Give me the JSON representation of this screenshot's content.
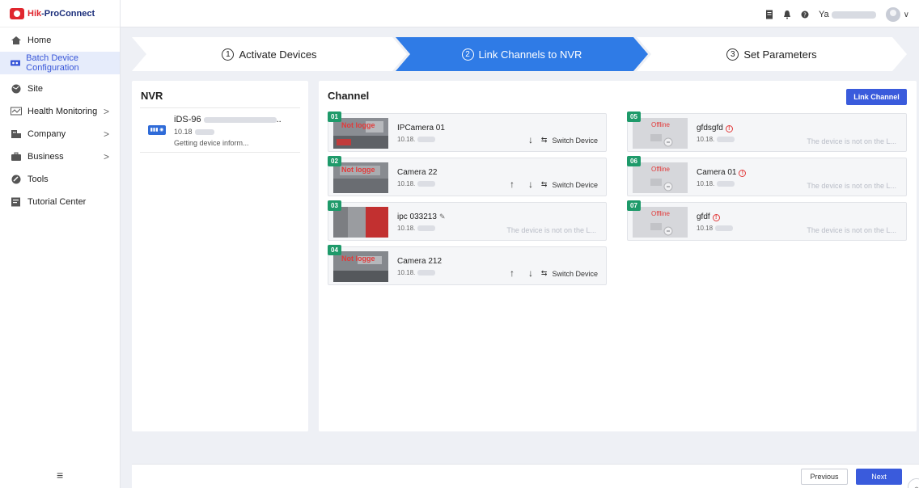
{
  "app": {
    "logo_hik": "Hik",
    "logo_rest": "-ProConnect"
  },
  "sidebar": {
    "items": [
      {
        "label": "Home",
        "icon": "home-icon"
      },
      {
        "label": "Batch Device Configuration",
        "icon": "batch-config-icon",
        "active": true
      },
      {
        "label": "Site",
        "icon": "site-icon"
      },
      {
        "label": "Health Monitoring",
        "icon": "health-monitoring-icon",
        "chevron": ">"
      },
      {
        "label": "Company",
        "icon": "company-icon",
        "chevron": ">"
      },
      {
        "label": "Business",
        "icon": "business-icon",
        "chevron": ">"
      },
      {
        "label": "Tools",
        "icon": "tools-icon"
      },
      {
        "label": "Tutorial Center",
        "icon": "tutorial-icon"
      }
    ],
    "collapse_glyph": "≡"
  },
  "topbar": {
    "user_prefix": "Ya",
    "dropdown": "∨"
  },
  "steps": [
    {
      "num": "1",
      "label": "Activate Devices"
    },
    {
      "num": "2",
      "label": "Link Channels to NVR",
      "active": true
    },
    {
      "num": "3",
      "label": "Set Parameters"
    }
  ],
  "nvr": {
    "title": "NVR",
    "device": {
      "name_prefix": "iDS-96",
      "name_suffix": "..",
      "ip_prefix": "10.18",
      "status": "Getting device inform..."
    }
  },
  "channel": {
    "title": "Channel",
    "link_button": "Link Channel",
    "switch_label": "Switch Device",
    "not_on_lan": "The device is not on the L...",
    "offline_label": "Offline",
    "not_logged": "Not logge",
    "left": [
      {
        "num": "01",
        "name": "IPCamera 01",
        "ip": "10.18.",
        "up": false,
        "down": true,
        "switch": true
      },
      {
        "num": "02",
        "name": "Camera 22",
        "ip": "10.18.",
        "up": true,
        "down": true,
        "switch": true
      },
      {
        "num": "03",
        "name": "ipc 033213",
        "ip": "10.18.",
        "edit": true,
        "notlan": true
      },
      {
        "num": "04",
        "name": "Camera 212",
        "ip": "10.18.",
        "up": true,
        "down": true,
        "switch": true
      }
    ],
    "right": [
      {
        "num": "05",
        "name": "gfdsgfd",
        "ip": "10.18."
      },
      {
        "num": "06",
        "name": "Camera 01",
        "ip": "10.18."
      },
      {
        "num": "07",
        "name": "gfdf",
        "ip": "10.18"
      }
    ]
  },
  "footer": {
    "previous": "Previous",
    "next": "Next"
  },
  "colors": {
    "accent": "#3a5bdc",
    "step_active": "#2f7be6",
    "channel_badge": "#1e9a6a",
    "error": "#e23a3a"
  }
}
